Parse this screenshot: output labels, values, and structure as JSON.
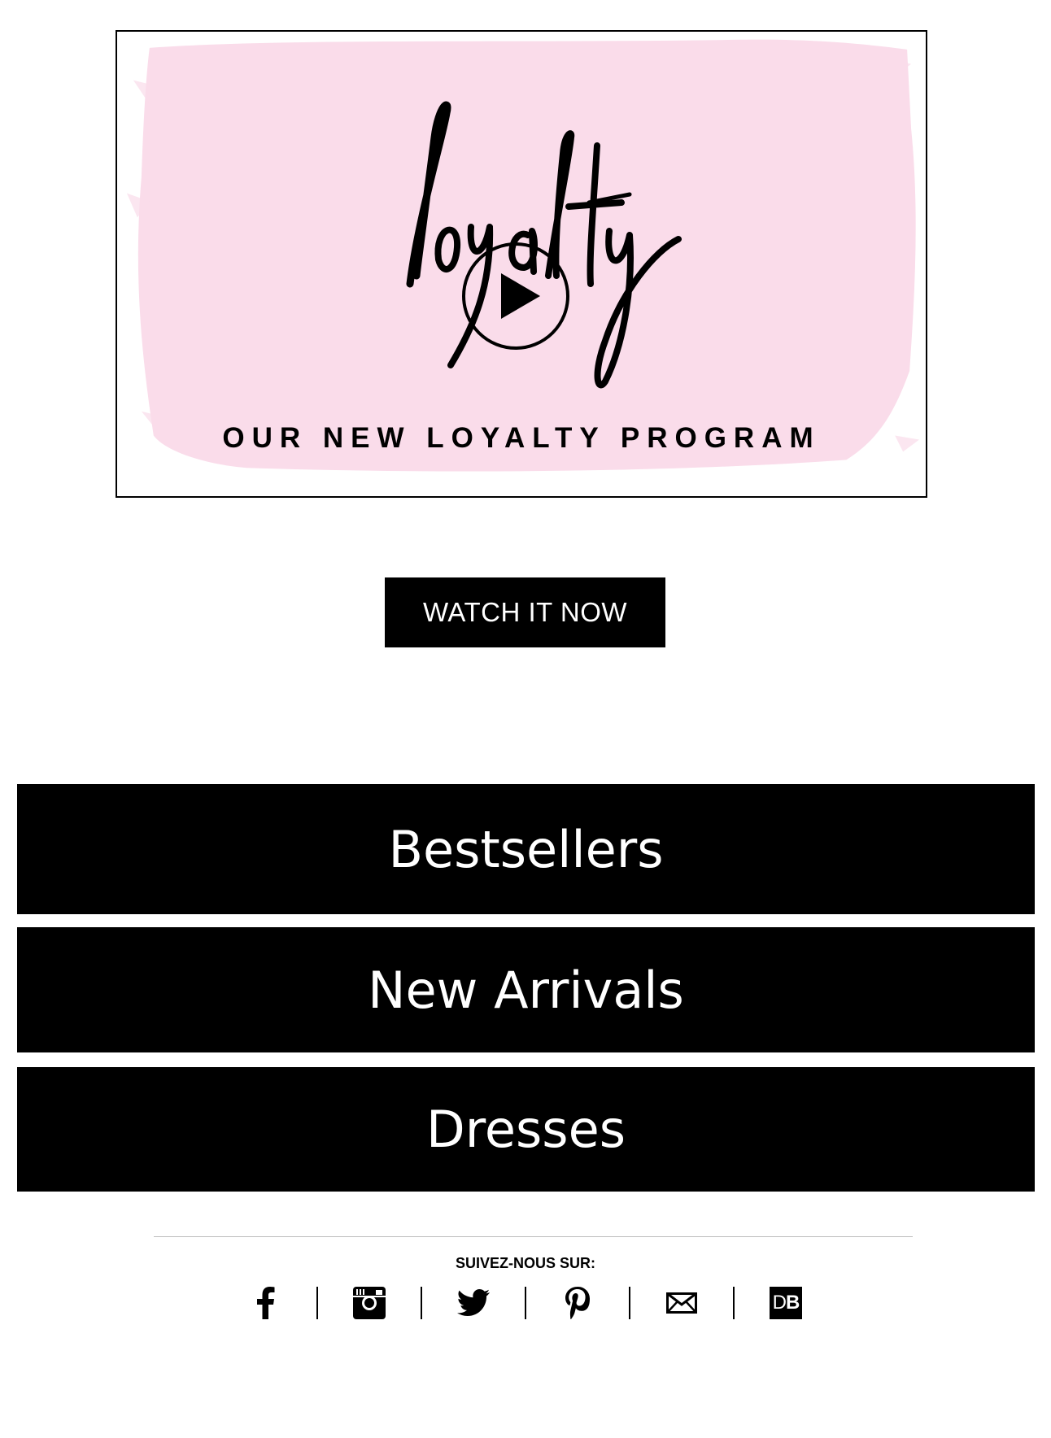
{
  "hero": {
    "logo_text": "loyalty",
    "title": "OUR NEW LOYALTY PROGRAM",
    "paint_color": "#fadcea"
  },
  "watch_button": {
    "label": "WATCH IT NOW"
  },
  "categories": [
    {
      "label": "Bestsellers"
    },
    {
      "label": "New Arrivals"
    },
    {
      "label": "Dresses"
    }
  ],
  "footer": {
    "follow_label": "SUIVEZ-NOUS SUR:",
    "social": [
      {
        "icon": "facebook-icon"
      },
      {
        "icon": "instagram-icon"
      },
      {
        "icon": "twitter-icon"
      },
      {
        "icon": "pinterest-icon"
      },
      {
        "icon": "email-icon"
      },
      {
        "icon": "db-icon",
        "letters_d": "D",
        "letters_b": "B"
      }
    ]
  }
}
